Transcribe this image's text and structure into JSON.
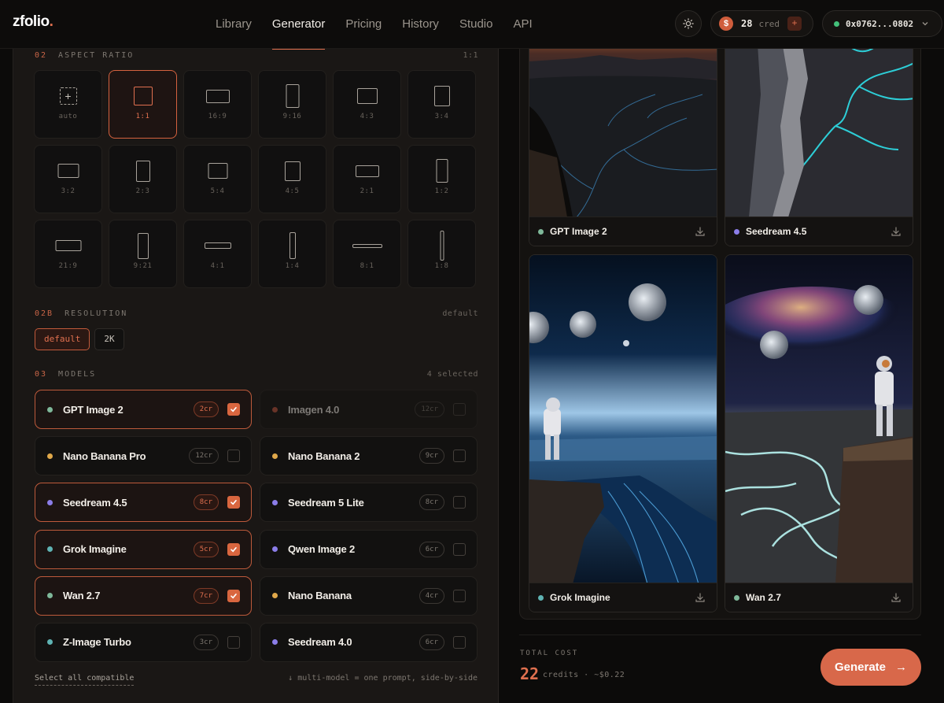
{
  "brand": {
    "logo": "zfolio",
    "logo_dot": "."
  },
  "nav": [
    {
      "label": "Library",
      "active": false
    },
    {
      "label": "Generator",
      "active": true
    },
    {
      "label": "Pricing",
      "active": false
    },
    {
      "label": "History",
      "active": false
    },
    {
      "label": "Studio",
      "active": false
    },
    {
      "label": "API",
      "active": false
    }
  ],
  "header": {
    "theme_icon": "sun-icon",
    "credits_icon_glyph": "$",
    "credits_value": "28",
    "credits_unit": "cred",
    "credits_add": "+",
    "wallet_address": "0x0762...0802"
  },
  "aspect_ratio": {
    "num": "02",
    "title": "ASPECT RATIO",
    "current": "1:1",
    "options": [
      "auto",
      "1:1",
      "16:9",
      "9:16",
      "4:3",
      "3:4",
      "3:2",
      "2:3",
      "5:4",
      "4:5",
      "2:1",
      "1:2",
      "21:9",
      "9:21",
      "4:1",
      "1:4",
      "8:1",
      "1:8"
    ],
    "selected": "1:1"
  },
  "resolution": {
    "num": "02B",
    "title": "RESOLUTION",
    "current": "default",
    "options": [
      {
        "label": "default",
        "active": true
      },
      {
        "label": "2K",
        "active": false
      }
    ]
  },
  "models": {
    "num": "03",
    "title": "MODELS",
    "selected_count": "4 selected",
    "items": [
      {
        "name": "GPT Image 2",
        "cost": "2cr",
        "selected": true,
        "disabled": false,
        "color": "#7fb89a"
      },
      {
        "name": "Imagen 4.0",
        "cost": "12cr",
        "selected": false,
        "disabled": true,
        "color": "#c8553d"
      },
      {
        "name": "Nano Banana Pro",
        "cost": "12cr",
        "selected": false,
        "disabled": false,
        "color": "#e0a84a"
      },
      {
        "name": "Nano Banana 2",
        "cost": "9cr",
        "selected": false,
        "disabled": false,
        "color": "#e0a84a"
      },
      {
        "name": "Seedream 4.5",
        "cost": "8cr",
        "selected": true,
        "disabled": false,
        "color": "#8b7de8"
      },
      {
        "name": "Seedream 5 Lite",
        "cost": "8cr",
        "selected": false,
        "disabled": false,
        "color": "#8b7de8"
      },
      {
        "name": "Grok Imagine",
        "cost": "5cr",
        "selected": true,
        "disabled": false,
        "color": "#5fb3b3"
      },
      {
        "name": "Qwen Image 2",
        "cost": "6cr",
        "selected": false,
        "disabled": false,
        "color": "#8b7de8"
      },
      {
        "name": "Wan 2.7",
        "cost": "7cr",
        "selected": true,
        "disabled": false,
        "color": "#7fb89a"
      },
      {
        "name": "Nano Banana",
        "cost": "4cr",
        "selected": false,
        "disabled": false,
        "color": "#e0a84a"
      },
      {
        "name": "Z-Image Turbo",
        "cost": "3cr",
        "selected": false,
        "disabled": false,
        "color": "#5fb3b3"
      },
      {
        "name": "Seedream 4.0",
        "cost": "6cr",
        "selected": false,
        "disabled": false,
        "color": "#8b7de8"
      }
    ],
    "select_all": "Select all compatible",
    "hint": "↓ multi-model = one prompt, side-by-side"
  },
  "results": [
    {
      "model": "GPT Image 2",
      "color": "#7fb89a",
      "icon": "download-icon"
    },
    {
      "model": "Seedream 4.5",
      "color": "#8b7de8",
      "icon": "download-icon"
    },
    {
      "model": "Grok Imagine",
      "color": "#5fb3b3",
      "icon": "download-icon"
    },
    {
      "model": "Wan 2.7",
      "color": "#7fb89a",
      "icon": "download-icon"
    }
  ],
  "footer": {
    "total_label": "TOTAL COST",
    "total_value": "22",
    "total_unit": "credits · ~$0.22",
    "generate_label": "Generate",
    "generate_arrow": "→"
  },
  "colors": {
    "accent": "#d8684a",
    "background": "#0c0b0a",
    "panel": "#1a1715"
  }
}
